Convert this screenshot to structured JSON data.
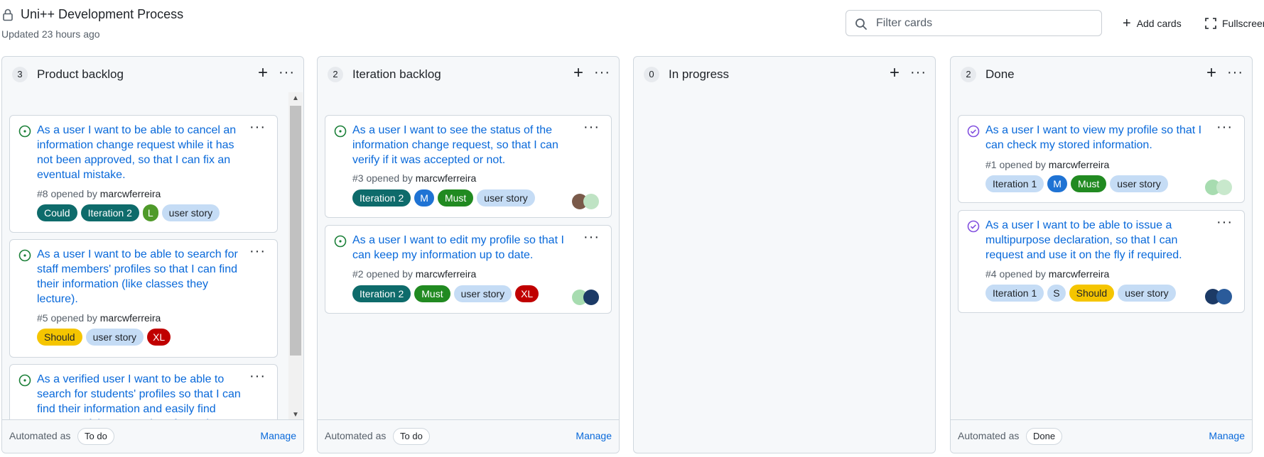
{
  "header": {
    "title": "Uni++ Development Process",
    "updated": "Updated 23 hours ago",
    "filter_placeholder": "Filter cards",
    "add_cards": "Add cards",
    "fullscreen": "Fullscreen"
  },
  "colors": {
    "link": "#0969da",
    "open_status": "#1a7f37",
    "closed_status": "#8250df",
    "label_iteration": "#0e6b6b",
    "label_must": "#218a21",
    "label_should": "#f5c500",
    "label_could": "#0e6b6b",
    "label_user_story": "#c5dcf5",
    "label_xl": "#c00000",
    "label_m": "#1f73d4",
    "label_l": "#4f9a2a"
  },
  "columns": [
    {
      "count": "3",
      "name": "Product backlog",
      "automated_label": "Automated as",
      "automated_value": "To do",
      "manage": "Manage",
      "cards": [
        {
          "title": "As a user I want to be able to cancel an information change request while it has not been approved, so that I can fix an eventual mistake.",
          "number": "#8",
          "opened_by": "opened by",
          "author": "marcwferreira",
          "labels": [
            "Could",
            "Iteration 2",
            "L",
            "user story"
          ]
        },
        {
          "title": "As a user I want to be able to search for staff members' profiles so that I can find their information (like classes they lecture).",
          "number": "#5",
          "opened_by": "opened by",
          "author": "marcwferreira",
          "labels": [
            "Should",
            "user story",
            "XL"
          ]
        },
        {
          "title": "As a verified user I want to be able to search for students' profiles so that I can find their information and easily find partners of the same class for projects.",
          "number": "",
          "opened_by": "",
          "author": "",
          "labels": []
        }
      ]
    },
    {
      "count": "2",
      "name": "Iteration backlog",
      "automated_label": "Automated as",
      "automated_value": "To do",
      "manage": "Manage",
      "cards": [
        {
          "title": "As a user I want to see the status of the information change request, so that I can verify if it was accepted or not.",
          "number": "#3",
          "opened_by": "opened by",
          "author": "marcwferreira",
          "labels": [
            "Iteration 2",
            "M",
            "Must",
            "user story"
          ]
        },
        {
          "title": "As a user I want to edit my profile so that I can keep my information up to date.",
          "number": "#2",
          "opened_by": "opened by",
          "author": "marcwferreira",
          "labels": [
            "Iteration 2",
            "Must",
            "user story",
            "XL"
          ]
        }
      ]
    },
    {
      "count": "0",
      "name": "In progress",
      "cards": []
    },
    {
      "count": "2",
      "name": "Done",
      "automated_label": "Automated as",
      "automated_value": "Done",
      "manage": "Manage",
      "cards": [
        {
          "title": "As a user I want to view my profile so that I can check my stored information.",
          "number": "#1",
          "opened_by": "opened by",
          "author": "marcwferreira",
          "labels": [
            "Iteration 1",
            "M",
            "Must",
            "user story"
          ]
        },
        {
          "title": "As a user I want to be able to issue a multipurpose declaration, so that I can request and use it on the fly if required.",
          "number": "#4",
          "opened_by": "opened by",
          "author": "marcwferreira",
          "labels": [
            "Iteration 1",
            "S",
            "Should",
            "user story"
          ]
        }
      ]
    }
  ]
}
